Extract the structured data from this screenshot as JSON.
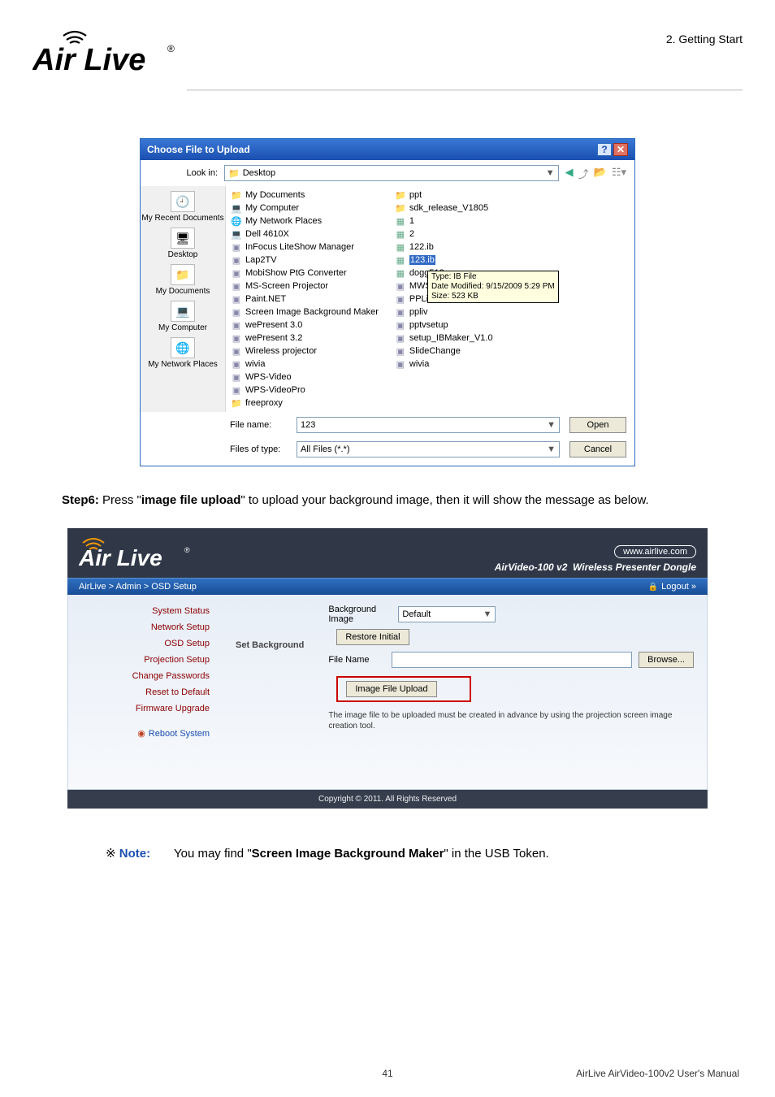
{
  "header": {
    "chapter": "2.  Getting  Start",
    "logo_text": "Air Live"
  },
  "filedialog": {
    "title": "Choose File to Upload",
    "lookin_label": "Look in:",
    "lookin_value": "Desktop",
    "places": [
      {
        "label": "My Recent Documents"
      },
      {
        "label": "Desktop"
      },
      {
        "label": "My Documents"
      },
      {
        "label": "My Computer"
      },
      {
        "label": "My Network Places"
      }
    ],
    "col1": [
      {
        "icon": "folder",
        "name": "My Documents"
      },
      {
        "icon": "pc",
        "name": "My Computer"
      },
      {
        "icon": "net",
        "name": "My Network Places"
      },
      {
        "icon": "pc",
        "name": "Dell 4610X"
      },
      {
        "icon": "app",
        "name": "InFocus LiteShow Manager"
      },
      {
        "icon": "app",
        "name": "Lap2TV"
      },
      {
        "icon": "app",
        "name": "MobiShow PtG Converter"
      },
      {
        "icon": "app",
        "name": "MS-Screen Projector"
      },
      {
        "icon": "app",
        "name": "Paint.NET"
      },
      {
        "icon": "app",
        "name": "Screen Image Background Maker"
      },
      {
        "icon": "app",
        "name": "wePresent 3.0"
      },
      {
        "icon": "app",
        "name": "wePresent 3.2"
      },
      {
        "icon": "app",
        "name": "Wireless projector"
      },
      {
        "icon": "app",
        "name": "wivia"
      },
      {
        "icon": "app",
        "name": "WPS-Video"
      },
      {
        "icon": "app",
        "name": "WPS-VideoPro"
      },
      {
        "icon": "folder",
        "name": "freeproxy"
      }
    ],
    "col2": [
      {
        "icon": "folder",
        "name": "ppt"
      },
      {
        "icon": "folder",
        "name": "sdk_release_V1805"
      },
      {
        "icon": "file",
        "name": "1"
      },
      {
        "icon": "file",
        "name": "2"
      },
      {
        "icon": "file",
        "name": "122.ib"
      },
      {
        "icon": "file-sel",
        "name": "123.ib"
      },
      {
        "icon": "file",
        "name": "dogg512"
      },
      {
        "icon": "app",
        "name": "MWS"
      },
      {
        "icon": "app",
        "name": "PPLiv"
      },
      {
        "icon": "app",
        "name": "ppliv"
      },
      {
        "icon": "app",
        "name": "pptvsetup"
      },
      {
        "icon": "app",
        "name": "setup_IBMaker_V1.0"
      },
      {
        "icon": "app",
        "name": "SlideChange"
      },
      {
        "icon": "app",
        "name": "wivia"
      }
    ],
    "tooltip": {
      "l1": "Type: IB File",
      "l2": "Date Modified: 9/15/2009 5:29 PM",
      "l3": "Size: 523 KB"
    },
    "filename_label": "File name:",
    "filename_value": "123",
    "filetype_label": "Files of type:",
    "filetype_value": "All Files (*.*)",
    "open_btn": "Open",
    "cancel_btn": "Cancel"
  },
  "step6": {
    "prefix": "Step6: ",
    "t1": "Press \"",
    "b1": "image file upload",
    "t2": "\" to upload your background image, then it will show the message as below."
  },
  "webconsole": {
    "brand_url": "www.airlive.com",
    "product_name": "AirVideo-100 v2",
    "product_sub": "Wireless Presenter Dongle",
    "crumbs": "AirLive > Admin > OSD Setup",
    "logout": "Logout »",
    "side": {
      "items": [
        "System Status",
        "Network Setup",
        "OSD Setup",
        "Projection Setup",
        "Change Passwords",
        "Reset to Default",
        "Firmware Upgrade"
      ],
      "reboot": "Reboot System"
    },
    "set_bg_label": "Set Background",
    "bg_image_label": "Background Image",
    "bg_dd": "Default",
    "restore_btn": "Restore Initial",
    "file_name_label": "File Name",
    "browse_btn": "Browse...",
    "upload_btn": "Image File Upload",
    "note": "The image file to be uploaded must be created in advance by using the projection screen image creation tool.",
    "footer": "Copyright © 2011. All Rights Reserved"
  },
  "note": {
    "star": "※",
    "word": "Note:",
    "t1": "You may find \"",
    "b1": "Screen Image Background Maker",
    "t2": "\" in the USB Token."
  },
  "pagefooter": {
    "num": "41",
    "text": "AirLive  AirVideo-100v2  User's  Manual"
  }
}
